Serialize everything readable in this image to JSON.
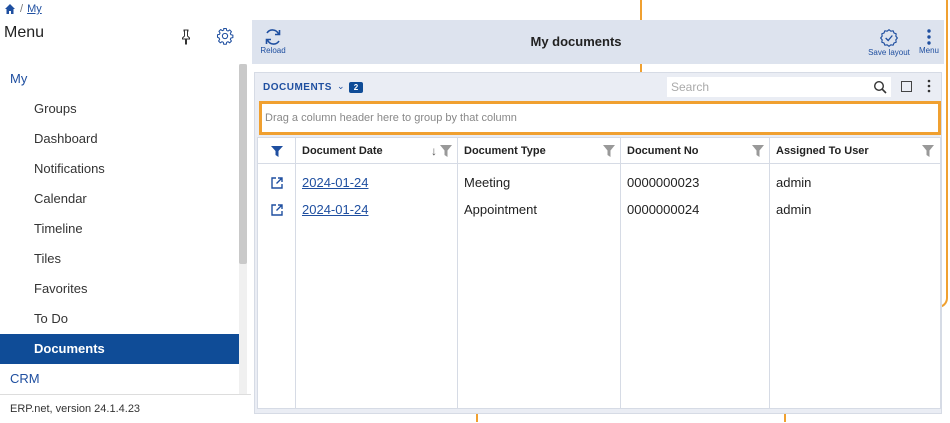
{
  "breadcrumb": {
    "current": "My"
  },
  "sidebar": {
    "title": "Menu",
    "items": [
      {
        "label": "My",
        "type": "section"
      },
      {
        "label": "Groups",
        "type": "item"
      },
      {
        "label": "Dashboard",
        "type": "item"
      },
      {
        "label": "Notifications",
        "type": "item"
      },
      {
        "label": "Calendar",
        "type": "item"
      },
      {
        "label": "Timeline",
        "type": "item"
      },
      {
        "label": "Tiles",
        "type": "item"
      },
      {
        "label": "Favorites",
        "type": "item"
      },
      {
        "label": "To Do",
        "type": "item"
      },
      {
        "label": "Documents",
        "type": "item",
        "active": true
      },
      {
        "label": "CRM",
        "type": "section"
      }
    ],
    "footer": "ERP.net, version 24.1.4.23"
  },
  "toolbar": {
    "reload_label": "Reload",
    "page_title": "My documents",
    "save_layout_label": "Save layout",
    "menu_label": "Menu"
  },
  "panel": {
    "label": "DOCUMENTS",
    "count": "2",
    "search_placeholder": "Search"
  },
  "groupby_hint": "Drag a column header here to group by that column",
  "grid": {
    "columns": [
      "Document Date",
      "Document Type",
      "Document No",
      "Assigned To User"
    ],
    "rows": [
      {
        "date": "2024-01-24",
        "type": "Meeting",
        "no": "0000000023",
        "user": "admin"
      },
      {
        "date": "2024-01-24",
        "type": "Appointment",
        "no": "0000000024",
        "user": "admin"
      }
    ]
  },
  "colors": {
    "accent": "#0f4c97",
    "highlight": "#f0a030",
    "toolbar_bg": "#dde3ee"
  },
  "icons": [
    "home-icon",
    "pin-icon",
    "gear-icon",
    "reload-icon",
    "save-layout-icon",
    "more-vertical-icon",
    "search-icon",
    "filter-icon",
    "sort-down-icon",
    "open-external-icon"
  ]
}
